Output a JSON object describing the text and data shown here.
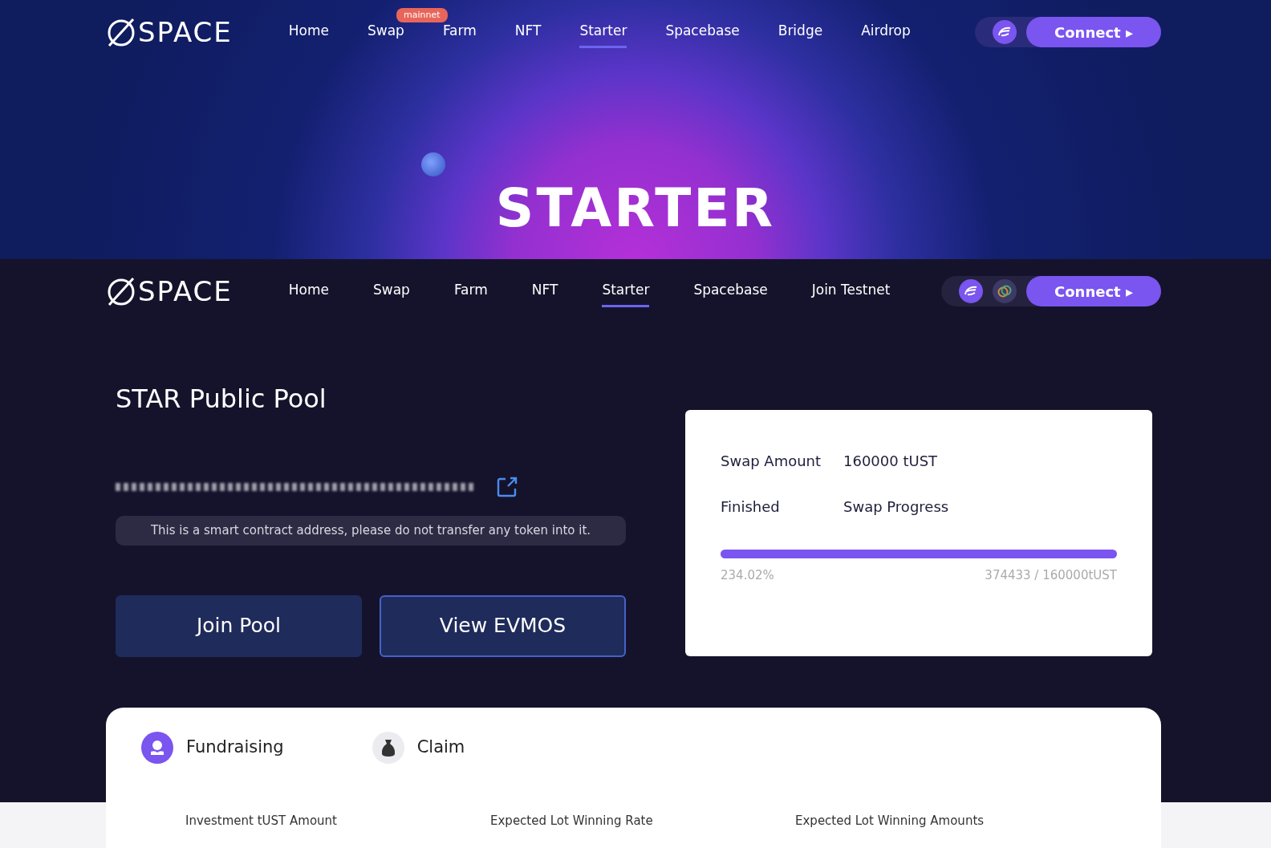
{
  "hero_nav": {
    "logo": "SPACE",
    "items": [
      {
        "label": "Home",
        "selected": false
      },
      {
        "label": "Swap",
        "selected": false,
        "badge": "mainnet"
      },
      {
        "label": "Farm",
        "selected": false
      },
      {
        "label": "NFT",
        "selected": false
      },
      {
        "label": "Starter",
        "selected": true
      },
      {
        "label": "Spacebase",
        "selected": false
      },
      {
        "label": "Bridge",
        "selected": false
      },
      {
        "label": "Airdrop",
        "selected": false
      }
    ],
    "connect": "Connect ▸",
    "wallet_icons": [
      {
        "kind": "evmos"
      }
    ]
  },
  "hero": {
    "title": "STARTER"
  },
  "main_nav": {
    "logo": "SPACE",
    "items": [
      {
        "label": "Home",
        "selected": false
      },
      {
        "label": "Swap",
        "selected": false
      },
      {
        "label": "Farm",
        "selected": false
      },
      {
        "label": "NFT",
        "selected": false
      },
      {
        "label": "Starter",
        "selected": true
      },
      {
        "label": "Spacebase",
        "selected": false
      },
      {
        "label": "Join Testnet",
        "selected": false
      }
    ],
    "connect": "Connect ▸",
    "wallet_icons": [
      {
        "kind": "evmos"
      },
      {
        "kind": "rings"
      }
    ]
  },
  "pool": {
    "title": "STAR Public Pool",
    "address_redacted": true,
    "warning": "This is a smart contract address, please do not transfer any token into it.",
    "buttons": [
      {
        "label": "Join Pool",
        "kind": "filled"
      },
      {
        "label": "View EVMOS",
        "kind": "outline"
      }
    ]
  },
  "swap_card": {
    "rows": [
      [
        "Swap Amount",
        "160000 tUST"
      ],
      [
        "Finished",
        "Swap Progress"
      ]
    ],
    "level": 1,
    "percent": "234.02%",
    "amounts": "374433 / 160000tUST"
  },
  "tabs": [
    {
      "label": "Fundraising",
      "selected": true
    },
    {
      "label": "Claim",
      "selected": false
    }
  ],
  "columns": [
    "Investment tUST Amount",
    "Expected Lot Winning Rate",
    "Expected Lot Winning Amounts"
  ]
}
